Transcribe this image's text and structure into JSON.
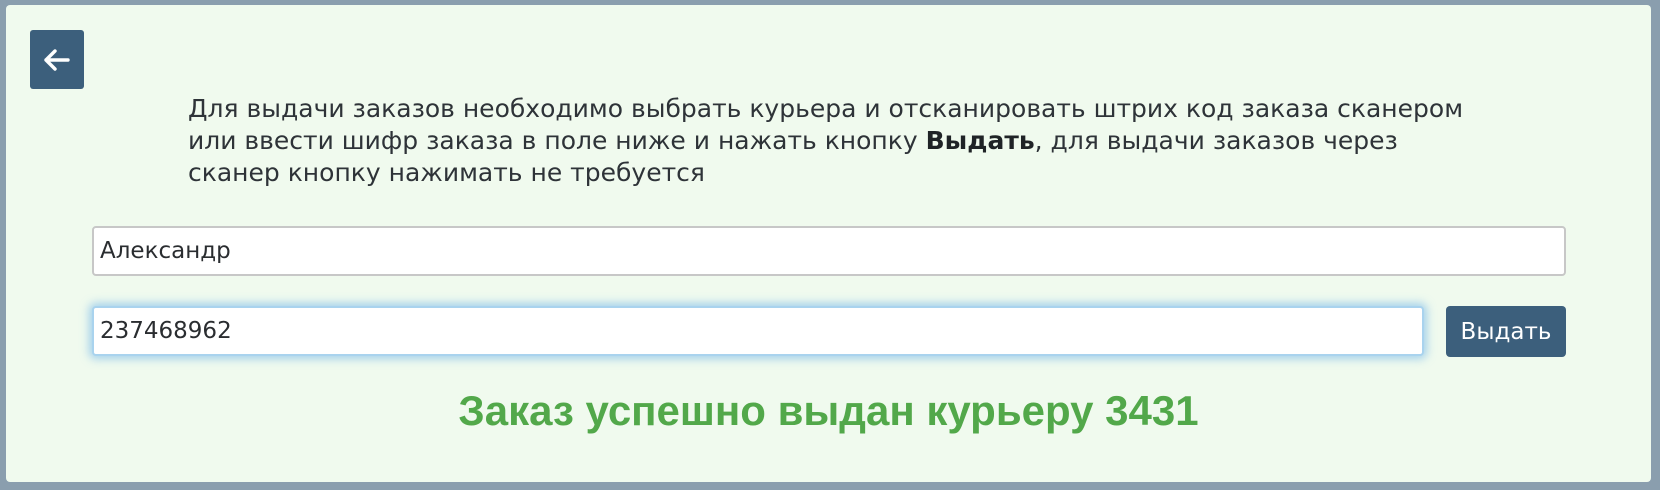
{
  "back_button": {
    "icon": "arrow-left-icon"
  },
  "instructions": {
    "before_bold": "Для выдачи заказов необходимо выбрать курьера и отсканировать штрих код заказа сканером или ввести шифр заказа в поле ниже и нажать кнопку ",
    "bold": "Выдать",
    "after_bold": ", для выдачи заказов через сканер кнопку нажимать не требуется"
  },
  "courier_field": {
    "value": "Александр"
  },
  "order_field": {
    "value": "237468962"
  },
  "issue_button": {
    "label": "Выдать"
  },
  "status": {
    "message": "Заказ успешно выдан курьеру 3431"
  },
  "colors": {
    "button_bg": "#3c5f7c",
    "panel_bg": "#f0faee",
    "success_text": "#52a84a",
    "focus_glow": "#66afe9"
  }
}
